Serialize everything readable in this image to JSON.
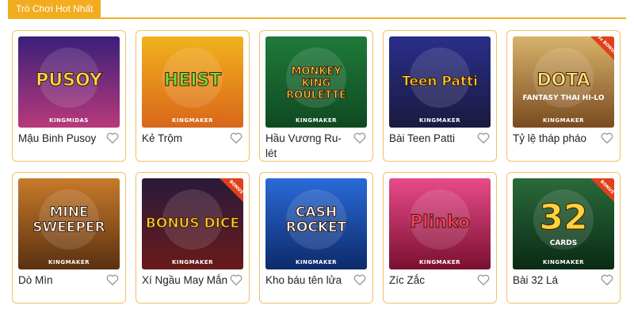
{
  "section": {
    "title": "Trò Chơi Hot Nhất"
  },
  "games": [
    {
      "name": "Mậu Binh Pusoy",
      "art_text": "PUSOY",
      "provider_logo": "KINGMIDAS",
      "badge": "",
      "icon": "heart-icon",
      "bg1": "#3a1f7a",
      "bg2": "#b8397a",
      "art_color": "#ffd84a"
    },
    {
      "name": "Kẻ Trộm",
      "art_text": "HEIST",
      "provider_logo": "KINGMAKER",
      "badge": "",
      "icon": "heart-icon",
      "bg1": "#f2b21d",
      "bg2": "#d9661a",
      "art_color": "#7bd83a"
    },
    {
      "name": "Hầu Vương Ru-lét",
      "art_text": "MONKEY KING ROULETTE",
      "provider_logo": "KINGMAKER",
      "badge": "",
      "icon": "heart-icon",
      "bg1": "#1f7a3a",
      "bg2": "#0f4a22",
      "art_color": "#ffd24a"
    },
    {
      "name": "Bài Teen Patti",
      "art_text": "Teen Patti",
      "provider_logo": "KINGMAKER",
      "badge": "",
      "icon": "heart-icon",
      "bg1": "#2a2e8a",
      "bg2": "#1a1a40",
      "art_color": "#ffcf3a"
    },
    {
      "name": "Tỷ lệ tháp pháo",
      "art_text": "DOTA",
      "art_subtext": "FANTASY THAI HI-LO",
      "provider_logo": "KINGMAKER",
      "badge": "2x BONUS",
      "icon": "heart-icon",
      "bg1": "#d8b46a",
      "bg2": "#7a4a20",
      "art_color": "#ffe17a"
    },
    {
      "name": "Dò Mìn",
      "art_text": "MINE SWEEPER",
      "provider_logo": "KINGMAKER",
      "badge": "",
      "icon": "heart-icon",
      "bg1": "#c77a2a",
      "bg2": "#5a3010",
      "art_color": "#ffffff"
    },
    {
      "name": "Xí Ngầu May Mắn",
      "art_text": "BONUS DICE",
      "provider_logo": "KINGMAKER",
      "badge": "BONUS",
      "icon": "heart-icon",
      "bg1": "#2a1a3a",
      "bg2": "#6a1a1a",
      "art_color": "#ffcc2a"
    },
    {
      "name": "Kho báu tên lửa",
      "art_text": "CASH ROCKET",
      "provider_logo": "KINGMAKER",
      "badge": "",
      "icon": "heart-icon",
      "bg1": "#2a6ad8",
      "bg2": "#0d2a6a",
      "art_color": "#ffffff"
    },
    {
      "name": "Zíc Zắc",
      "art_text": "Plinko",
      "provider_logo": "KINGMAKER",
      "badge": "",
      "icon": "heart-icon",
      "bg1": "#e84a8a",
      "bg2": "#7a1030",
      "art_color": "#ff3a6a"
    },
    {
      "name": "Bài 32 Lá",
      "art_text": "32",
      "art_subtext": "CARDS",
      "provider_logo": "KINGMAKER",
      "badge": "BONUS",
      "icon": "heart-icon",
      "bg1": "#2a6a3a",
      "bg2": "#0a2a14",
      "art_color": "#ffd23a"
    }
  ]
}
